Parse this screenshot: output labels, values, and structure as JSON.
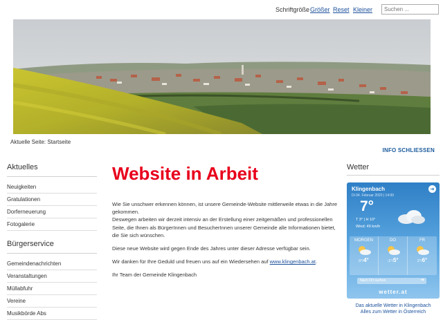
{
  "topbar": {
    "font_size_label": "Schriftgröße",
    "bigger_label": "Größer",
    "reset_label": "Reset",
    "smaller_label": "Kleiner",
    "search_placeholder": "Suchen ..."
  },
  "breadcrumb": "Aktuelle Seite: Startseite",
  "info_close_label": "INFO SCHLIESSEN",
  "sidebar": {
    "section1_title": "Aktuelles",
    "section1_items": [
      {
        "label": "Neuigkeiten"
      },
      {
        "label": "Gratulationen"
      },
      {
        "label": "Dorferneuerung"
      },
      {
        "label": "Fotogalerie"
      }
    ],
    "section2_title": "Bürgerservice",
    "section2_items": [
      {
        "label": "Gemeindenachrichten"
      },
      {
        "label": "Veranstaltungen"
      },
      {
        "label": "Müllabfuhr"
      },
      {
        "label": "Vereine"
      },
      {
        "label": "Musikbörde Abs"
      }
    ]
  },
  "main": {
    "title": "Website in Arbeit",
    "p1": "Wie Sie unschwer erkennen können, ist unsere Gemeinde-Website mittlerweile etwas in die Jahre gekommen.",
    "p2": "Deswegen arbeiten wir derzeit intensiv an der Erstellung einer zeitgemäßen und professionellen Seite, die Ihnen als BürgerInnen und BesucherInnen unserer Gemeinde alle Informationen bietet, die Sie sich wünschen.",
    "p3": "Diese neue Website wird gegen Ende des Jahres unter dieser Adresse verfügbar sein.",
    "p4_prefix": "Wir danken für Ihre Geduld und freuen uns auf ein Wiedersehen auf ",
    "p4_link": "www.klingenbach.at",
    "p4_suffix": ".",
    "p5": "Ihr Team der Gemeinde Klingenbach"
  },
  "weather": {
    "title": "Wetter",
    "town": "Klingenbach",
    "date": "Di 04. Februar 2020 | 14:00",
    "temp": "7°",
    "range": "T 3° | H 10°",
    "wind": "Wind: 49 km/h",
    "days": [
      {
        "name": "MORGEN",
        "low": "0°/",
        "high": "4°"
      },
      {
        "name": "DO",
        "low": "-1°/",
        "high": "5°"
      },
      {
        "name": "FR",
        "low": "2°/",
        "high": "6°"
      }
    ],
    "search_label": "Nach Ort suchen",
    "brand": "wetter.at",
    "link1": "Das aktuelle Wetter in Klingenbach",
    "link2": "Alles zum Wetter in Österreich"
  },
  "colors": {
    "title_red": "#e8001c",
    "link_blue": "#1a4f9a",
    "widget_blue": "#2f7fc6"
  }
}
